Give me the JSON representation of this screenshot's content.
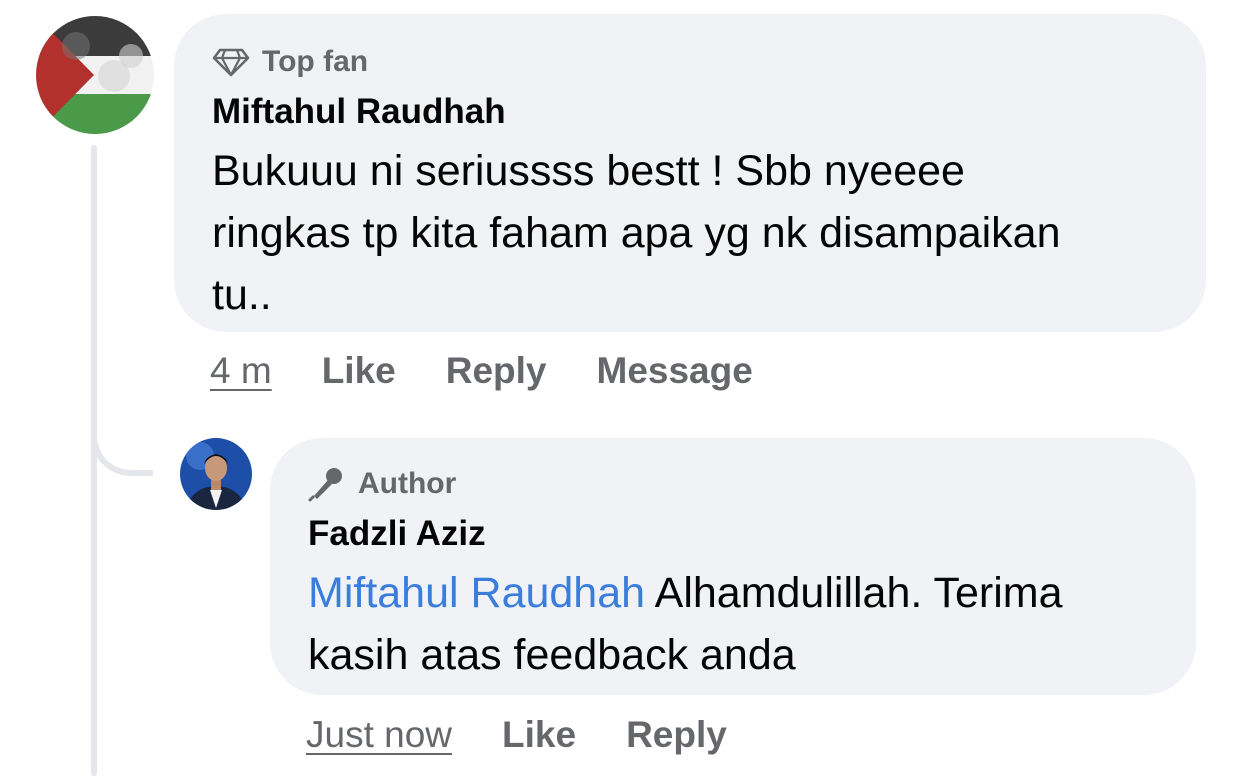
{
  "comment": {
    "badge": "Top fan",
    "author": "Miftahul Raudhah",
    "text_line1": "Bukuuu ni seriussss bestt ! Sbb nyeeee",
    "text_line2": "ringkas tp kita faham apa yg nk disampaikan",
    "text_line3": "tu..",
    "time": "4 m",
    "actions": {
      "like": "Like",
      "reply": "Reply",
      "message": "Message"
    }
  },
  "reply": {
    "badge": "Author",
    "author": "Fadzli Aziz",
    "mention": "Miftahul Raudhah",
    "text_line1_rest": " Alhamdulillah. Terima",
    "text_line2": "kasih atas feedback anda",
    "time": "Just now",
    "actions": {
      "like": "Like",
      "reply": "Reply"
    }
  },
  "colors": {
    "bubble": "#f0f2f5",
    "secondary_text": "#65676b",
    "mention": "#3b7ddd",
    "thread_line": "#e4e6eb"
  },
  "icons": {
    "top_fan": "diamond-icon",
    "author": "microphone-icon"
  }
}
